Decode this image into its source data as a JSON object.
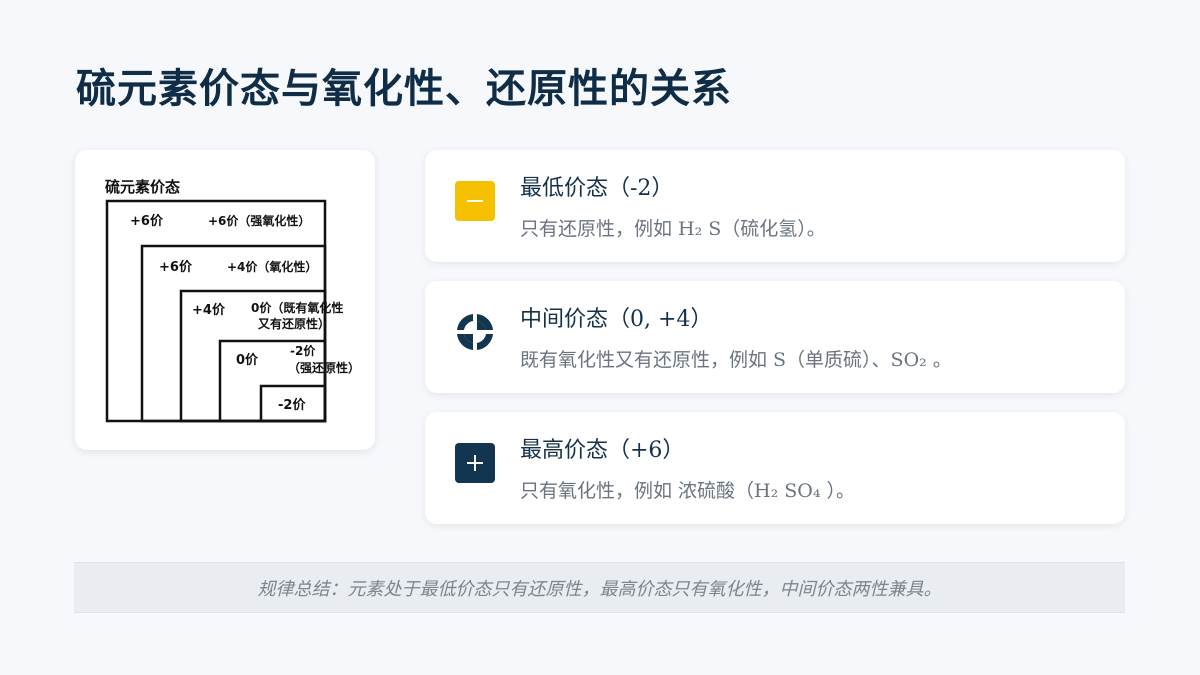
{
  "title": "硫元素价态与氧化性、还原性的关系",
  "diagram": {
    "heading": "硫元素价态",
    "steps": [
      {
        "box_label": "+6价",
        "note_lines": [
          "+6价（强氧化性）"
        ]
      },
      {
        "box_label": "+6价",
        "note_lines": [
          "+4价（氧化性）"
        ]
      },
      {
        "box_label": "+4价",
        "note_lines": [
          "0价（既有氧化性",
          "又有还原性）"
        ]
      },
      {
        "box_label": "0价",
        "note_lines": [
          "-2价",
          "（强还原性）"
        ]
      },
      {
        "box_label": "-2价",
        "note_lines": []
      }
    ]
  },
  "cards": {
    "low": {
      "icon": "minus-icon",
      "icon_color": "#f5c000",
      "heading": "最低价态（-2）",
      "desc": "只有还原性，例如 H₂ S（硫化氢）。"
    },
    "mid": {
      "icon": "split-circle-icon",
      "icon_color": "#123550",
      "heading": "中间价态（0, +4）",
      "desc": "既有氧化性又有还原性，例如 S（单质硫）、SO₂ 。"
    },
    "high": {
      "icon": "plus-icon",
      "icon_color": "#123550",
      "heading": "最高价态（+6）",
      "desc": "只有氧化性，例如 浓硫酸（H₂ SO₄ ）。"
    }
  },
  "summary": "规律总结：元素处于最低价态只有还原性，最高价态只有氧化性，中间价态两性兼具。"
}
